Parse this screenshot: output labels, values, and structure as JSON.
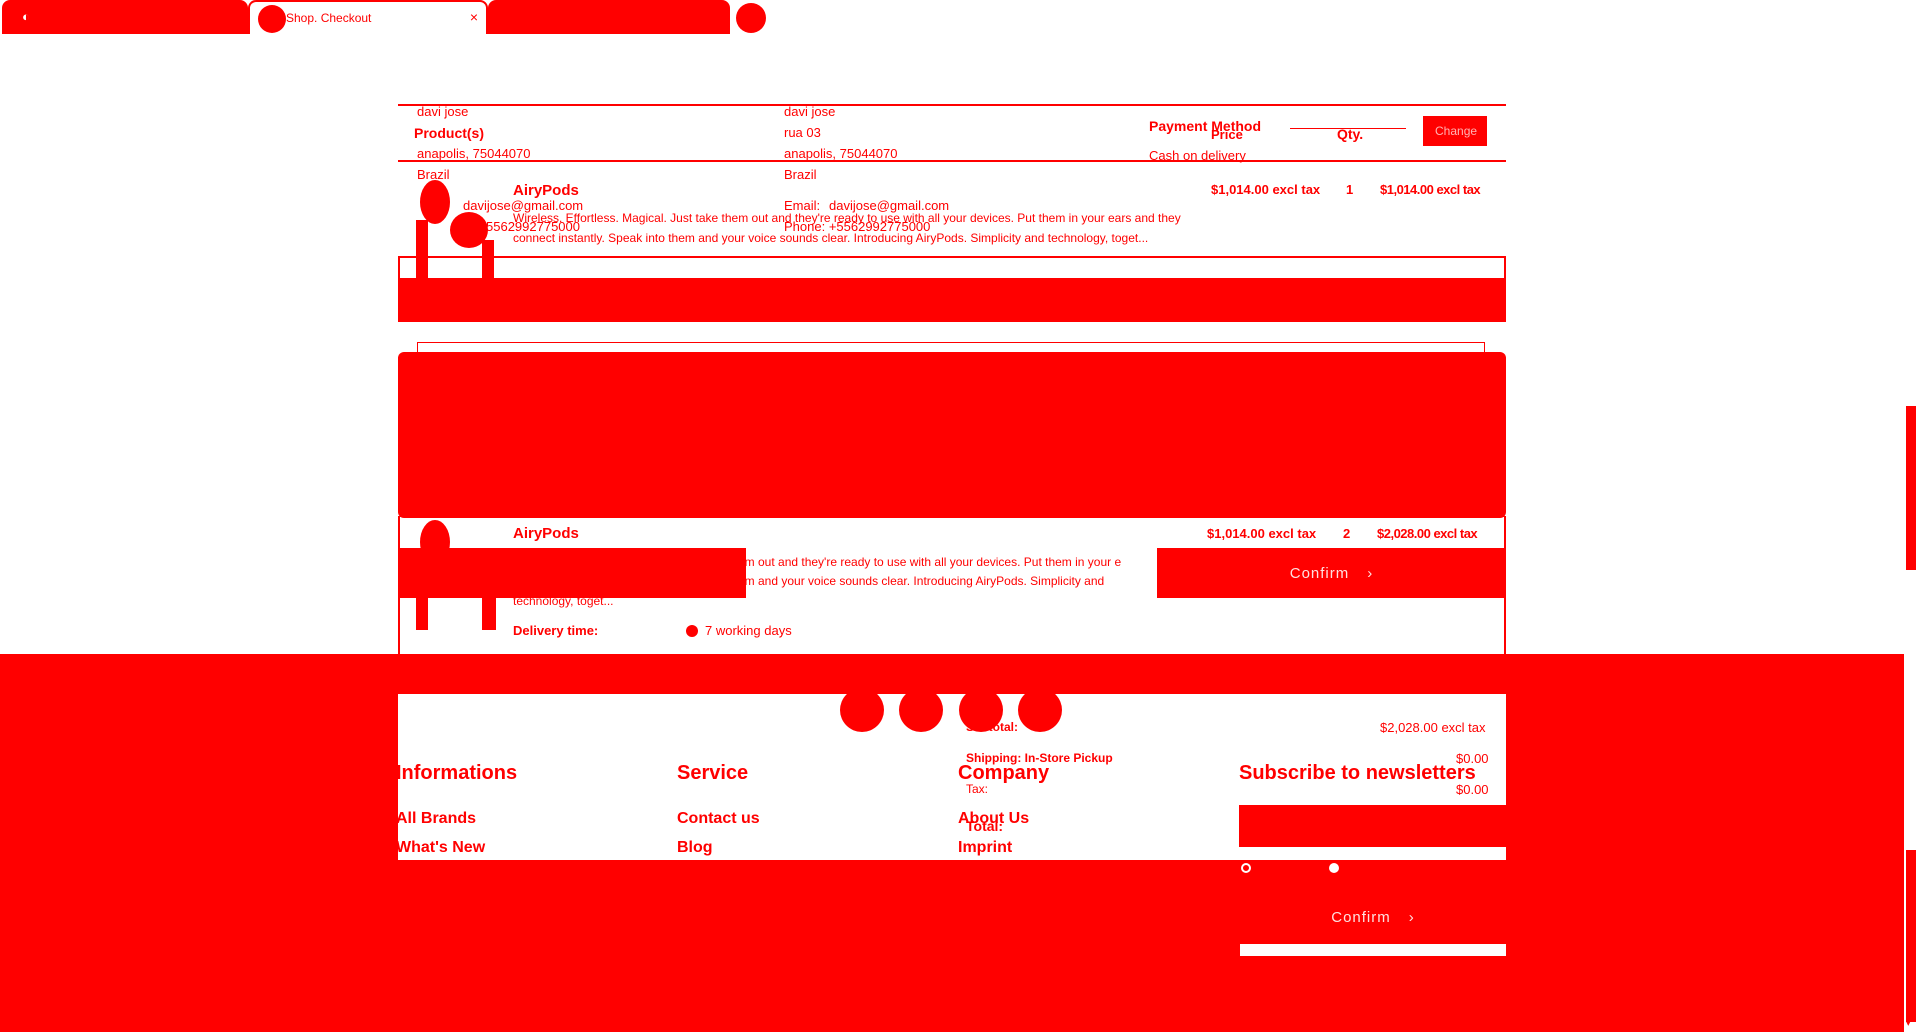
{
  "tabs": [
    {
      "label": "",
      "icon": "browser-logo-icon"
    },
    {
      "label": "Shop. Checkout",
      "icon": "favicon-icon",
      "close": "×"
    },
    {
      "label": "",
      "icon": ""
    }
  ],
  "address": {
    "billing": {
      "name": "davi jose",
      "street": "",
      "city": "anapolis, 75044070",
      "country": "Brazil",
      "email": "davijose@gmail.com",
      "phone": "5562992775000"
    },
    "shipping": {
      "name": "davi jose",
      "street": "rua 03",
      "city": "anapolis, 75044070",
      "country": "Brazil",
      "email_label": "Email:",
      "email": "davijose@gmail.com",
      "phone": "Phone: +5562992775000"
    }
  },
  "payment": {
    "title": "Payment Method",
    "value": "Cash on delivery",
    "change_label": "Change"
  },
  "table_top": {
    "headers": {
      "product": "Product(s)",
      "price": "Price",
      "qty": "Qty."
    },
    "row": {
      "name": "AiryPods",
      "desc": "Wireless. Effortless. Magical. Just take them out and they're ready to use with all your devices. Put them in your ears and they connect instantly. Speak into them and your voice sounds clear. Introducing AiryPods. Simplicity and technology, toget...",
      "price": "$1,014.00 excl tax",
      "qty": "1",
      "total": "$1,014.00 excl tax"
    }
  },
  "table_bottom": {
    "row": {
      "name": "AiryPods",
      "desc_line1": "em out and they're ready to use with all your devices. Put them in your e",
      "desc_line2": "em and your voice sounds clear. Introducing AiryPods. Simplicity and",
      "desc_line3": "technology, toget...",
      "price": "$1,014.00 excl tax",
      "qty": "2",
      "total": "$2,028.00 excl tax",
      "delivery_label": "Delivery time:",
      "delivery_value": "7 working days"
    }
  },
  "confirm_label": "Confirm",
  "confirm_arrow": "›",
  "totals": {
    "subtotal_label": "Subtotal:",
    "subtotal_value": "$2,028.00 excl tax",
    "shipping_label": "Shipping: In-Store Pickup",
    "shipping_value": "$0.00",
    "tax_label": "Tax:",
    "tax_value": "$0.00",
    "total_label": "Total:"
  },
  "footer": {
    "informations": {
      "title": "Informations",
      "links": [
        "All Brands",
        "What's New"
      ]
    },
    "service": {
      "title": "Service",
      "links": [
        "Contact us",
        "Blog"
      ]
    },
    "company": {
      "title": "Company",
      "links": [
        "About Us",
        "Imprint"
      ]
    },
    "newsletter": {
      "title": "Subscribe to newsletters"
    }
  }
}
